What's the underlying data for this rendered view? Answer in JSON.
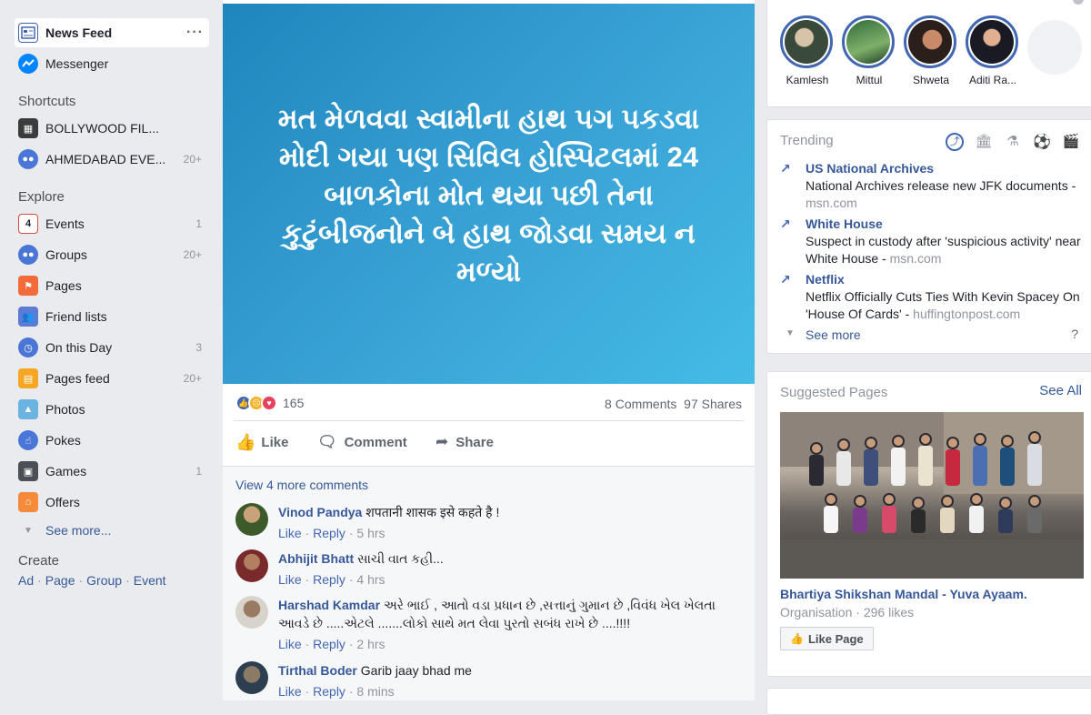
{
  "sidebar": {
    "news_feed": "News Feed",
    "messenger": "Messenger",
    "shortcuts_header": "Shortcuts",
    "shortcuts": [
      {
        "label": "BOLLYWOOD FIL...",
        "count": ""
      },
      {
        "label": "AHMEDABAD EVE...",
        "count": "20+"
      }
    ],
    "explore_header": "Explore",
    "explore": [
      {
        "label": "Events",
        "count": "1",
        "icon": "calendar-icon"
      },
      {
        "label": "Groups",
        "count": "20+",
        "icon": "groups-icon"
      },
      {
        "label": "Pages",
        "count": "",
        "icon": "flag-icon"
      },
      {
        "label": "Friend lists",
        "count": "",
        "icon": "friends-icon"
      },
      {
        "label": "On this Day",
        "count": "3",
        "icon": "clock-icon"
      },
      {
        "label": "Pages feed",
        "count": "20+",
        "icon": "pages-feed-icon"
      },
      {
        "label": "Photos",
        "count": "",
        "icon": "photos-icon"
      },
      {
        "label": "Pokes",
        "count": "",
        "icon": "poke-icon"
      },
      {
        "label": "Games",
        "count": "1",
        "icon": "games-icon"
      },
      {
        "label": "Offers",
        "count": "",
        "icon": "offers-icon"
      }
    ],
    "see_more": "See more...",
    "create_header": "Create",
    "create_links": [
      "Ad",
      "Page",
      "Group",
      "Event"
    ]
  },
  "post": {
    "banner_text": "મત મેળવવા સ્વામીના હાથ પગ પકડવા મોદી ગયા પણ સિવિલ હોસ્પિટલમાં 24 બાળકોના મોત થયા પછી તેના કુટુંબીજનોને બે હાથ જોડવા સમય ન મળ્યો",
    "reaction_count": "165",
    "comments_count": "8 Comments",
    "shares_count": "97 Shares",
    "like_label": "Like",
    "comment_label": "Comment",
    "share_label": "Share",
    "view_more": "View 4 more comments",
    "comments": [
      {
        "name": "Vinod Pandya",
        "text": "शपतानी शासक इसे कहते है !",
        "like": "Like",
        "reply": "Reply",
        "time": "5 hrs"
      },
      {
        "name": "Abhijit Bhatt",
        "text": "સાચી વાત કહી...",
        "like": "Like",
        "reply": "Reply",
        "time": "4 hrs"
      },
      {
        "name": "Harshad Kamdar",
        "text": "અરે ભાઈ , આતો વડા પ્રધાન છે ,સત્તાનું ગુમાન છે ,વિવંધ ખેલ ખેલતા આવડે છે .....એટલે .......લોકો સાથે મત લેવા પુરતો સબંધ રાખે છે ....!!!!",
        "like": "Like",
        "reply": "Reply",
        "time": "2 hrs"
      },
      {
        "name": "Tirthal Boder",
        "text": "Garib jaay bhad me",
        "like": "Like",
        "reply": "Reply",
        "time": "8 mins"
      }
    ]
  },
  "stories": {
    "items": [
      {
        "name": "Kamlesh"
      },
      {
        "name": "Mittul"
      },
      {
        "name": "Shweta"
      },
      {
        "name": "Aditi Ra..."
      }
    ]
  },
  "trending": {
    "header": "Trending",
    "items": [
      {
        "title": "US National Archives",
        "desc": "National Archives release new JFK documents",
        "src": "msn.com"
      },
      {
        "title": "White House",
        "desc": "Suspect in custody after 'suspicious activity' near White House",
        "src": "msn.com"
      },
      {
        "title": "Netflix",
        "desc": "Netflix Officially Cuts Ties With Kevin Spacey On 'House Of Cards'",
        "src": "huffingtonpost.com"
      }
    ],
    "see_more": "See more",
    "help": "?"
  },
  "suggested": {
    "header": "Suggested Pages",
    "see_all": "See All",
    "page_name": "Bhartiya Shikshan Mandal - Yuva Ayaam.",
    "category": "Organisation",
    "likes": "296 likes",
    "like_page": "Like Page"
  }
}
